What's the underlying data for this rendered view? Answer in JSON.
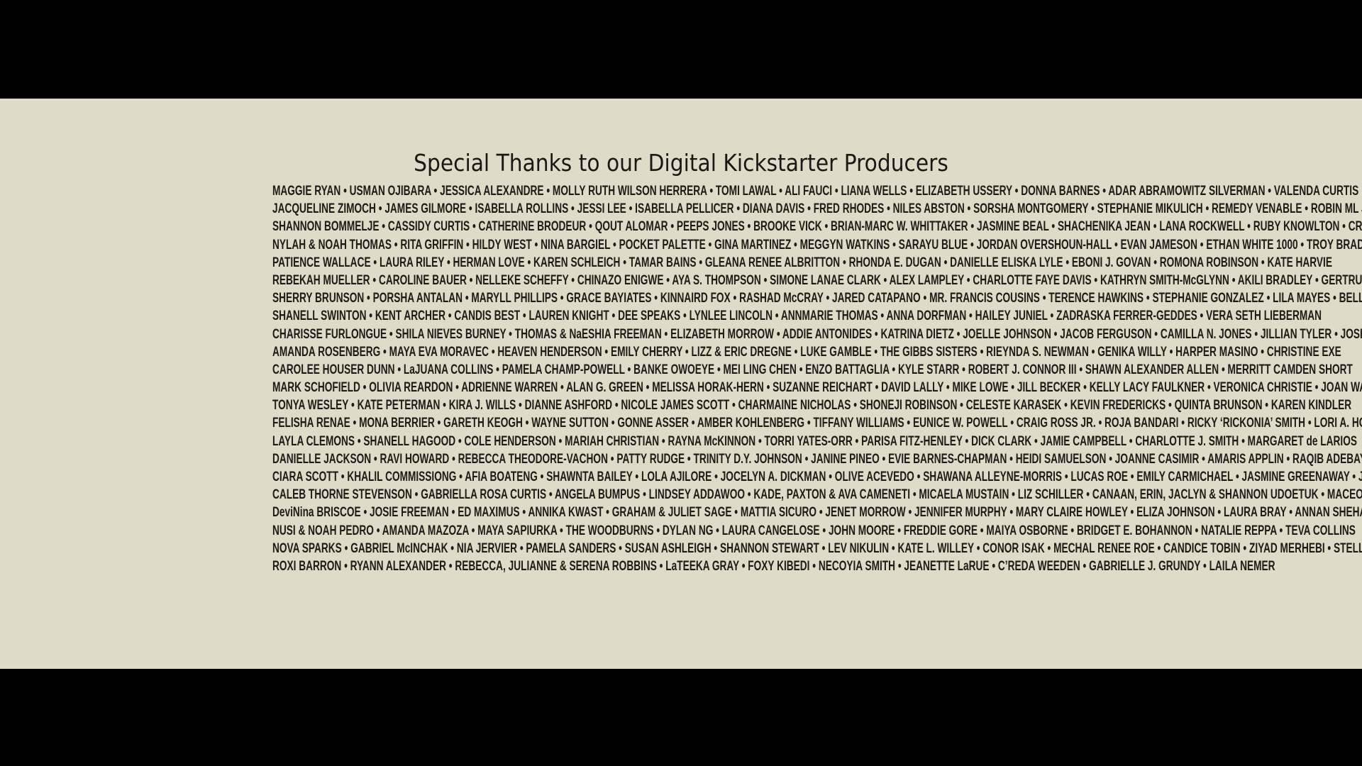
{
  "title": "Special Thanks to our Digital Kickstarter Producers",
  "lines": [
    "MAGGIE RYAN • USMAN OJIBARA • JESSICA ALEXANDRE • MOLLY RUTH WILSON HERRERA • TOMI LAWAL • ALI FAUCI • LIANA WELLS • ELIZABETH USSERY • DONNA BARNES • ADAR ABRAMOWITZ SILVERMAN • VALENDA CURTIS",
    "JACQUELINE ZIMOCH • JAMES GILMORE • ISABELLA ROLLINS • JESSI LEE • ISABELLA PELLICER • DIANA DAVIS • FRED RHODES • NILES ABSTON • SORSHA MONTGOMERY • STEPHANIE MIKULICH • REMEDY VENABLE • ROBIN ML JOHNSON",
    "SHANNON BOMMELJE • CASSIDY CURTIS • CATHERINE BRODEUR • QOUT ALOMAR • PEEPS JONES • BROOKE VICK • BRIAN-MARC W. WHITTAKER • JASMINE BEAL • SHACHENIKA JEAN • LANA ROCKWELL • RUBY KNOWLTON • CROSBY TATUM",
    "NYLAH & NOAH THOMAS • RITA GRIFFIN • HILDY WEST • NINA BARGIEL • POCKET PALETTE • GINA MARTINEZ • MEGGYN WATKINS • SARAYU BLUE • JORDAN OVERSHOUN-HALL • EVAN JAMESON • ETHAN WHITE 1000 • TROY BRADY",
    "PATIENCE WALLACE • LAURA RILEY • HERMAN LOVE • KAREN SCHLEICH • TAMAR BAINS • GLEANA RENEE ALBRITTON • RHONDA E. DUGAN • DANIELLE ELISKA LYLE • EBONI J. GOVAN • ROMONA ROBINSON • KATE HARVIE",
    "REBEKAH MUELLER • CAROLINE BAUER • NELLEKE SCHEFFY • CHINAZO ENIGWE • AYA S. THOMPSON • SIMONE LANAE CLARK • ALEX LAMPLEY • CHARLOTTE FAYE DAVIS • KATHRYN SMITH-McGLYNN • AKILI BRADLEY • GERTRUDE LOK",
    "SHERRY BRUNSON • PORSHA ANTALAN • MARYLL PHILLIPS • GRACE BAYIATES • KINNAIRD FOX • RASHAD McCRAY • JARED CATAPANO • MR. FRANCIS COUSINS • TERENCE HAWKINS • STEPHANIE GONZALEZ • LILA MAYES • BELLA SALATHE",
    "SHANELL SWINTON • KENT ARCHER • CANDIS BEST • LAUREN KNIGHT • DEE SPEAKS • LYNLEE LINCOLN • ANNMARIE THOMAS • ANNA DORFMAN • HAILEY JUNIEL • ZADRASKA FERRER-GEDDES • VERA SETH LIEBERMAN",
    "CHARISSE FURLONGUE • SHILA NIEVES BURNEY • THOMAS & NaESHIA FREEMAN • ELIZABETH MORROW • ADDIE ANTONIDES • KATRINA DIETZ • JOELLE JOHNSON • JACOB FERGUSON • CAMILLA N. JONES • JILLIAN TYLER • JOSH HORNE",
    "AMANDA ROSENBERG • MAYA EVA MORAVEC • HEAVEN HENDERSON • EMILY CHERRY • LIZZ & ERIC DREGNE • LUKE GAMBLE • THE GIBBS SISTERS • RIEYNDA S. NEWMAN • GENIKA WILLY • HARPER MASINO • CHRISTINE EXE",
    "CAROLEE HOUSER DUNN • LaJUANA COLLINS • PAMELA CHAMP-POWELL • BANKE OWOEYE • MEI LING CHEN • ENZO BATTAGLIA • KYLE STARR • ROBERT J. CONNOR III • SHAWN ALEXANDER ALLEN • MERRITT CAMDEN SHORT",
    "MARK SCHOFIELD • OLIVIA REARDON • ADRIENNE WARREN • ALAN G. GREEN • MELISSA HORAK-HERN • SUZANNE REICHART • DAVID LALLY • MIKE LOWE • JILL BECKER • KELLY LACY FAULKNER • VERONICA CHRISTIE • JOAN WALSH",
    "TONYA WESLEY • KATE PETERMAN • KIRA J. WILLS • DIANNE ASHFORD • NICOLE JAMES SCOTT • CHARMAINE NICHOLAS • SHONEJI ROBINSON • CELESTE KARASEK • KEVIN FREDERICKS • QUINTA BRUNSON • KAREN KINDLER",
    "FELISHA RENAE • MONA BERRIER • GARETH KEOGH • WAYNE SUTTON • GONNE ASSER • AMBER KOHLENBERG • TIFFANY WILLIAMS • EUNICE W. POWELL • CRAIG ROSS JR. • ROJA BANDARI • RICKY ‘RICKONIA’ SMITH • LORI A. HOWARD",
    "LAYLA CLEMONS • SHANELL HAGOOD • COLE HENDERSON • MARIAH CHRISTIAN • RAYNA McKINNON • TORRI YATES-ORR • PARISA FITZ-HENLEY • DICK CLARK • JAMIE CAMPBELL • CHARLOTTE J. SMITH • MARGARET de LARIOS",
    "DANIELLE JACKSON • RAVI HOWARD • REBECCA THEODORE-VACHON • PATTY RUDGE • TRINITY D.Y. JOHNSON • JANINE PINEO • EVIE BARNES-CHAPMAN • HEIDI SAMUELSON • JOANNE CASIMIR • AMARIS APPLIN • RAQIB ADEBAYO",
    "CIARA SCOTT • KHALIL COMMISSIONG • AFIA BOATENG • SHAWNTA BAILEY • LOLA AJILORE • JOCELYN A. DICKMAN • OLIVE ACEVEDO • SHAWANA ALLEYNE-MORRIS • LUCAS ROE • EMILY CARMICHAEL • JASMINE GREENAWAY • JOSH TABON",
    "CALEB THORNE STEVENSON • GABRIELLA ROSA CURTIS • ANGELA BUMPUS • LINDSEY ADDAWOO • KADE, PAXTON & AVA CAMENETI • MICAELA MUSTAIN • LIZ SCHILLER • CANAAN, ERIN, JACLYN & SHANNON UDOETUK • MACEO A. BOISSON",
    "DeviNina BRISCOE • JOSIE FREEMAN • ED MAXIMUS • ANNIKA KWAST • GRAHAM & JULIET SAGE • MATTIA SICURO • JENET MORROW • JENNIFER MURPHY • MARY CLAIRE HOWLEY • ELIZA JOHNSON • LAURA BRAY • ANNAN SHEHADI",
    "NUSI & NOAH PEDRO • AMANDA MAZOZA • MAYA SAPIURKA • THE WOODBURNS • DYLAN NG • LAURA CANGELOSE • JOHN MOORE • FREDDIE GORE • MAIYA OSBORNE • BRIDGET E. BOHANNON • NATALIE REPPA • TEVA COLLINS",
    "NOVA SPARKS • GABRIEL McINCHAK • NIA JERVIER • PAMELA SANDERS • SUSAN ASHLEIGH • SHANNON STEWART • LEV NIKULIN • KATE L. WILLEY • CONOR ISAK • MECHAL RENEE ROE • CANDICE TOBIN • ZIYAD MERHEBI • STELLA PHELPS",
    "ROXI BARRON • RYANN ALEXANDER • REBECCA, JULIANNE & SERENA ROBBINS • LaTEEKA GRAY • FOXY KIBEDI • NECOYIA SMITH • JEANETTE LaRUE • C’REDA WEEDEN • GABRIELLE J. GRUNDY • LAILA NEMER"
  ],
  "colors": {
    "letterbox": "#000000",
    "panel": "#e0dac8",
    "text": "#1e1a16"
  }
}
